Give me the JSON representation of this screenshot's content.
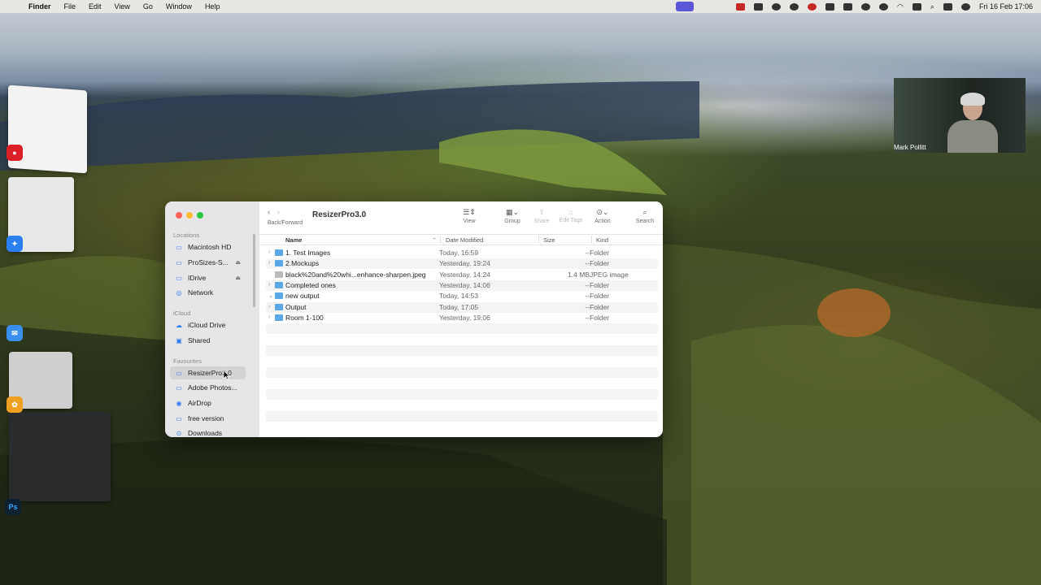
{
  "menubar": {
    "app": "Finder",
    "items": [
      "File",
      "Edit",
      "View",
      "Go",
      "Window",
      "Help"
    ],
    "datetime": "Fri 16 Feb  17:06"
  },
  "webcam": {
    "name": "Mark Pollitt"
  },
  "finder": {
    "title": "ResizerPro3.0",
    "nav_label": "Back/Forward",
    "toolbar": [
      {
        "label": "View",
        "icon": "list-view-icon",
        "enabled": true
      },
      {
        "label": "Group",
        "icon": "group-icon",
        "enabled": true
      },
      {
        "label": "Share",
        "icon": "share-icon",
        "enabled": false
      },
      {
        "label": "Edit Tags",
        "icon": "tag-icon",
        "enabled": false
      },
      {
        "label": "Action",
        "icon": "action-icon",
        "enabled": true
      },
      {
        "label": "Search",
        "icon": "search-icon",
        "enabled": true
      }
    ],
    "sidebar": {
      "locations_header": "Locations",
      "locations": [
        "Macintosh HD",
        "ProSizes-S...",
        "IDrive",
        "Network"
      ],
      "icloud_header": "iCloud",
      "icloud": [
        "iCloud Drive",
        "Shared"
      ],
      "favourites_header": "Favourites",
      "favourites": [
        "ResizerPro3.0",
        "Adobe Photos...",
        "AirDrop",
        "free version",
        "Downloads"
      ]
    },
    "columns": {
      "name": "Name",
      "date": "Date Modified",
      "size": "Size",
      "kind": "Kind"
    },
    "rows": [
      {
        "name": "1. Test Images",
        "date": "Today, 16:59",
        "size": "--",
        "kind": "Folder"
      },
      {
        "name": "2.Mockups",
        "date": "Yesterday, 19:24",
        "size": "--",
        "kind": "Folder"
      },
      {
        "name": "black%20and%20whi...enhance-sharpen.jpeg",
        "date": "Yesterday, 14:24",
        "size": "1.4 MB",
        "kind": "JPEG image"
      },
      {
        "name": "Completed ones",
        "date": "Yesterday, 14:06",
        "size": "--",
        "kind": "Folder"
      },
      {
        "name": "new output",
        "date": "Today, 14:53",
        "size": "--",
        "kind": "Folder"
      },
      {
        "name": "Output",
        "date": "Today, 17:05",
        "size": "--",
        "kind": "Folder"
      },
      {
        "name": "Room 1-100",
        "date": "Yesterday, 19:06",
        "size": "--",
        "kind": "Folder"
      }
    ]
  },
  "dock": {
    "ps_label": "Ps"
  }
}
